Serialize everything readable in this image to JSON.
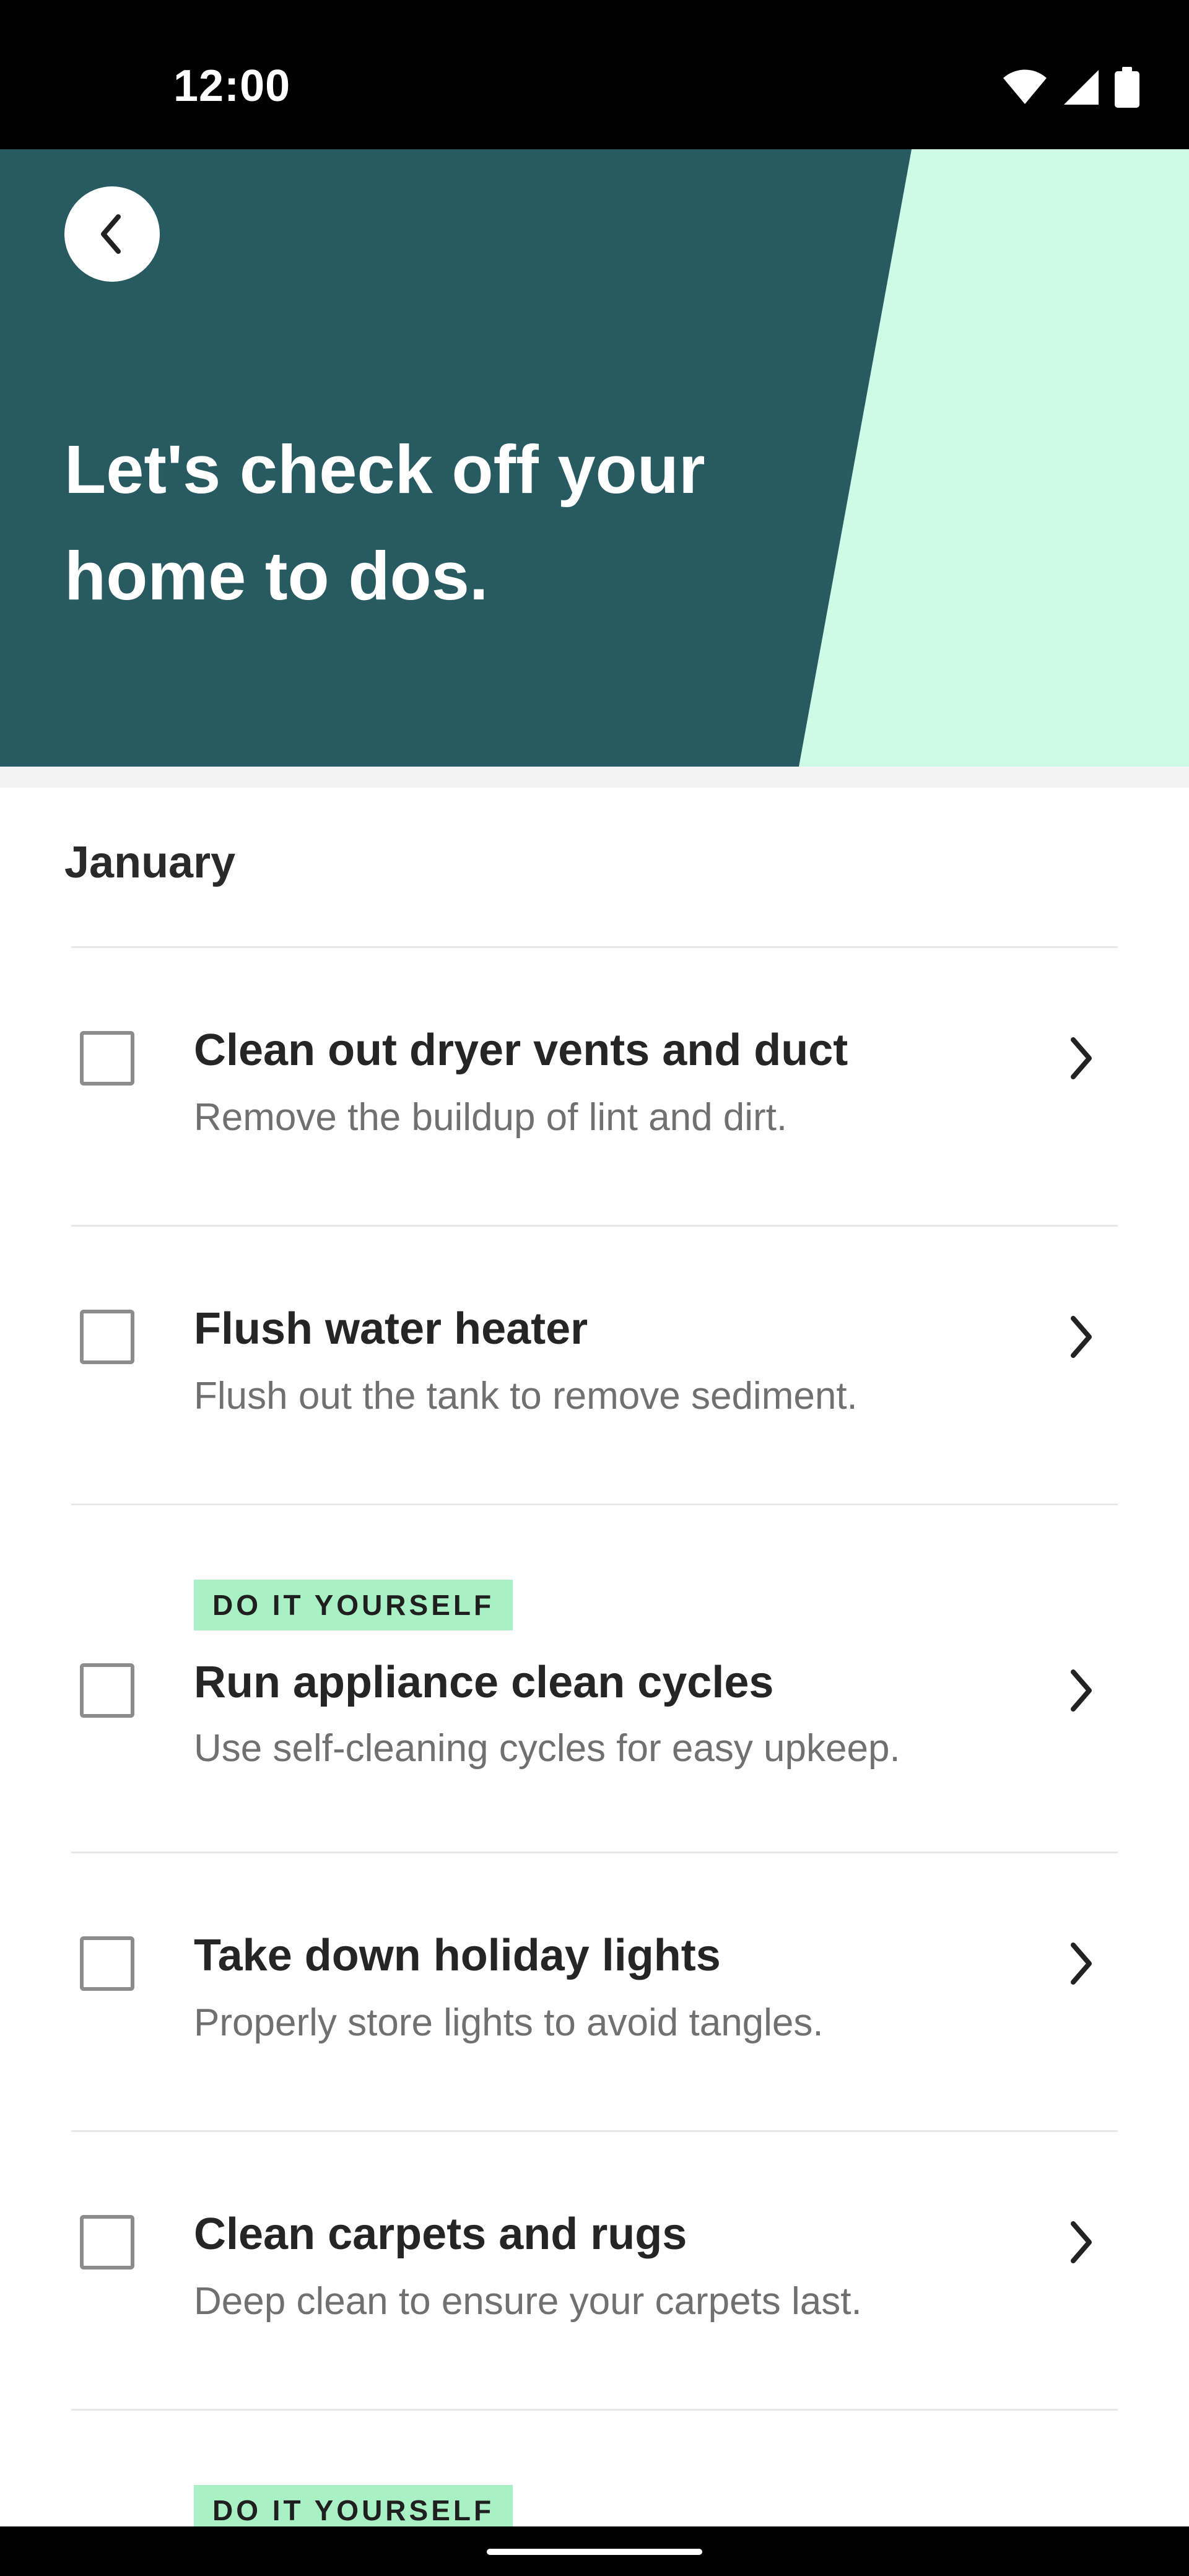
{
  "status_bar": {
    "time": "12:00",
    "icons": [
      "wifi-icon",
      "signal-icon",
      "battery-icon"
    ]
  },
  "header": {
    "back_icon": "chevron-left-icon",
    "title": "Let's check off your home to dos.",
    "colors": {
      "dark_panel": "#285a61",
      "accent_panel": "#cdfbe6"
    }
  },
  "month": "January",
  "tasks": [
    {
      "title": "Clean out dryer vents and duct",
      "description": "Remove the buildup of lint and dirt.",
      "badge": "",
      "checked": false
    },
    {
      "title": "Flush water heater",
      "description": "Flush out the tank to remove sediment.",
      "badge": "",
      "checked": false
    },
    {
      "title": "Run appliance clean cycles",
      "description": "Use self-cleaning cycles for easy upkeep.",
      "badge": "DO IT YOURSELF",
      "checked": false
    },
    {
      "title": "Take down holiday lights",
      "description": "Properly store lights to avoid tangles.",
      "badge": "",
      "checked": false
    },
    {
      "title": "Clean carpets and rugs",
      "description": "Deep clean to ensure your carpets last.",
      "badge": "",
      "checked": false
    },
    {
      "title": "",
      "description": "",
      "badge": "DO IT YOURSELF",
      "checked": false
    }
  ],
  "colors": {
    "badge_bg": "#a9f0c5",
    "title_text": "#252525",
    "description_text": "#707070"
  }
}
